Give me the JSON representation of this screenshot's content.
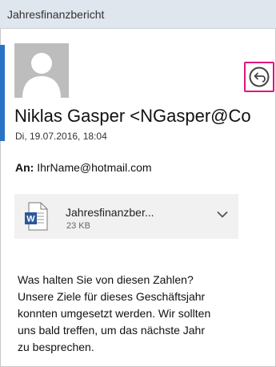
{
  "window": {
    "title": "Jahresfinanzbericht"
  },
  "colors": {
    "accent": "#2a72c6",
    "highlight": "#e0157f",
    "title_bar": "#dfe6ed",
    "attachment_bg": "#f1f1f1"
  },
  "message": {
    "sender": "Niklas Gasper <NGasper@Co",
    "date": "Di, 19.07.2016, 18:04",
    "to_label": "An:",
    "to_value": "IhrName@hotmail.com",
    "reply_icon": "reply-icon",
    "avatar_icon": "person-silhouette"
  },
  "attachment": {
    "name": "Jahresfinanzber...",
    "size": "23 KB",
    "icon": "word-document-icon",
    "expand_icon": "chevron-down-icon"
  },
  "body": {
    "lines": [
      "Was halten Sie von diesen Zahlen?",
      "Unsere Ziele für dieses Geschäftsjahr",
      "konnten umgesetzt werden. Wir sollten",
      "uns bald treffen, um das nächste Jahr",
      "zu besprechen."
    ]
  }
}
